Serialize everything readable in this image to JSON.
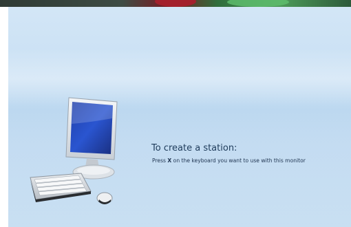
{
  "station": {
    "title": "To create a station:",
    "instruction_prefix": "Press ",
    "instruction_key": "X",
    "instruction_suffix": " on the keyboard you want to use with this monitor"
  },
  "icons": {
    "illustration": "computer-monitor-keyboard-mouse-icon"
  },
  "colors": {
    "background_top": "#d3e6f6",
    "background_mid": "#bcd8f0",
    "text": "#1e3b5a"
  }
}
